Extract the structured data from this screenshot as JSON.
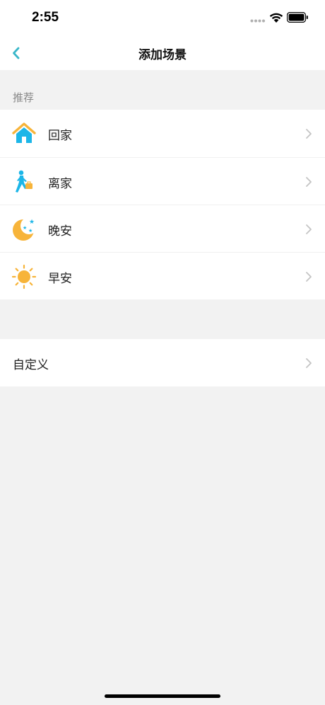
{
  "status_bar": {
    "time": "2:55"
  },
  "nav": {
    "title": "添加场景"
  },
  "section": {
    "header": "推荐"
  },
  "scenes": [
    {
      "label": "回家",
      "icon": "home-icon"
    },
    {
      "label": "离家",
      "icon": "leaving-person-icon"
    },
    {
      "label": "晚安",
      "icon": "moon-stars-icon"
    },
    {
      "label": "早安",
      "icon": "sun-icon"
    }
  ],
  "custom": {
    "label": "自定义"
  },
  "colors": {
    "accent": "#3ab7c9",
    "icon_blue": "#1cb6e8",
    "icon_orange": "#f7b43a",
    "background": "#f2f2f2"
  }
}
